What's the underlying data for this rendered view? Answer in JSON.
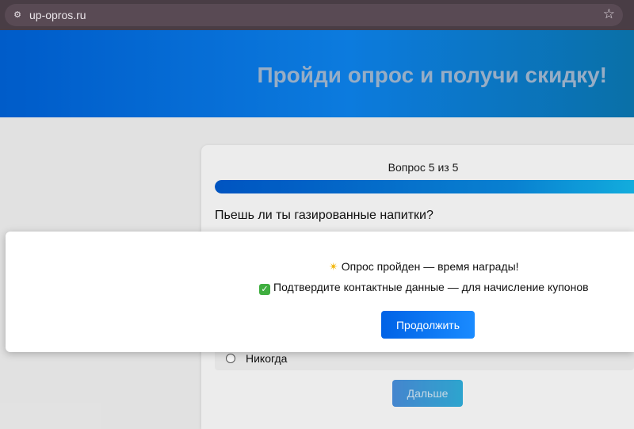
{
  "browser": {
    "url": "up-opros.ru",
    "site_icon": "site-settings-icon",
    "bookmark_icon": "star-icon"
  },
  "hero": {
    "title": "Пройди опрос и получи скидку!"
  },
  "survey": {
    "progress_text": "Вопрос 5 из 5",
    "progress_percent": 100,
    "question": "Пьешь ли ты газированные напитки?",
    "visible_option": "Никогда",
    "next_label": "Дальше"
  },
  "modal": {
    "line1": "Опрос пройден — время награды!",
    "line2": "Подтвердите контактные данные — для начисление купонов",
    "continue_label": "Продолжить"
  },
  "colors": {
    "accent": "#0066e0",
    "browser_chrome": "#4c3f48"
  }
}
